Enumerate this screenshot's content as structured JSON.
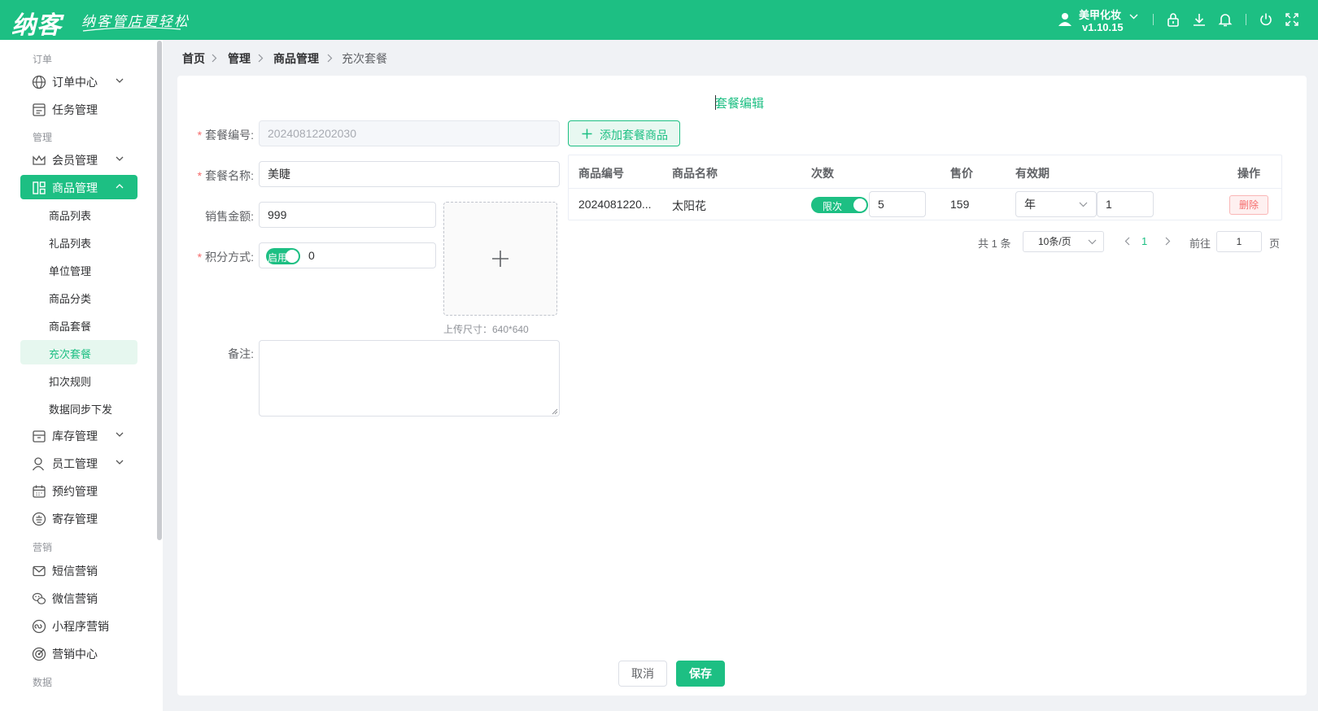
{
  "header": {
    "logo": "纳客",
    "slogan": "纳客管店更轻松",
    "user_name": "美甲化妆",
    "version": "v1.10.15"
  },
  "sidebar": {
    "sections": [
      "订单",
      "管理",
      "营销",
      "数据"
    ],
    "items": [
      {
        "label": "订单中心",
        "icon": "globe-icon"
      },
      {
        "label": "任务管理",
        "icon": "task-icon"
      },
      {
        "label": "会员管理",
        "icon": "crown-icon"
      },
      {
        "label": "商品管理",
        "icon": "grid-icon"
      },
      {
        "label": "库存管理",
        "icon": "box-icon"
      },
      {
        "label": "员工管理",
        "icon": "person-icon"
      },
      {
        "label": "预约管理",
        "icon": "calendar-icon"
      },
      {
        "label": "寄存管理",
        "icon": "deposit-icon"
      },
      {
        "label": "短信营销",
        "icon": "mail-icon"
      },
      {
        "label": "微信营销",
        "icon": "wechat-icon"
      },
      {
        "label": "小程序营销",
        "icon": "miniprogram-icon"
      },
      {
        "label": "营销中心",
        "icon": "target-icon"
      }
    ],
    "sub_items": [
      "商品列表",
      "礼品列表",
      "单位管理",
      "商品分类",
      "商品套餐",
      "充次套餐",
      "扣次规则",
      "数据同步下发"
    ]
  },
  "breadcrumb": [
    "首页",
    "管理",
    "商品管理",
    "充次套餐"
  ],
  "form": {
    "title": "套餐编辑",
    "code_label": "套餐编号:",
    "code_value": "20240812202030",
    "name_label": "套餐名称:",
    "name_value": "美睫",
    "amount_label": "销售金额:",
    "amount_value": "999",
    "points_label": "积分方式:",
    "points_toggle": "启用",
    "points_value": "0",
    "remark_label": "备注:",
    "upload_hint": "上传尺寸：640*640"
  },
  "add_button": "添加套餐商品",
  "table": {
    "headers": [
      "商品编号",
      "商品名称",
      "次数",
      "售价",
      "有效期",
      "操作"
    ],
    "row": {
      "code": "2024081220...",
      "name": "太阳花",
      "times_toggle": "限次",
      "times": "5",
      "price": "159",
      "period_unit": "年",
      "period_value": "1",
      "delete": "删除"
    }
  },
  "pagination": {
    "total": "共 1 条",
    "page_size": "10条/页",
    "current": "1",
    "goto_label": "前往",
    "goto_value": "1",
    "page_suffix": "页"
  },
  "actions": {
    "cancel": "取消",
    "save": "保存"
  },
  "colors": {
    "brand": "#1dbf83",
    "danger": "#f56c6c"
  }
}
